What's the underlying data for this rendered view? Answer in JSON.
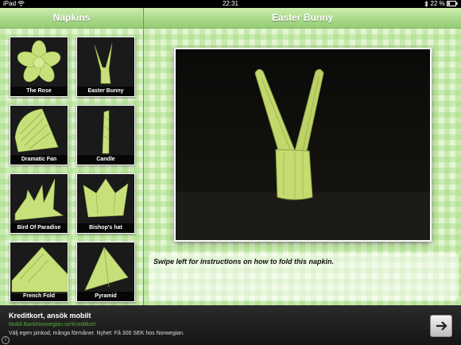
{
  "status_bar": {
    "device": "iPad",
    "wifi_icon": "wifi-icon",
    "time": "22:31",
    "battery_text": "22 %",
    "bluetooth_icon": "bluetooth-icon",
    "battery_icon": "battery-icon"
  },
  "sidebar": {
    "title": "Napkins",
    "items": [
      {
        "label": "The Rose"
      },
      {
        "label": "Easter Bunny"
      },
      {
        "label": "Dramatic Fan"
      },
      {
        "label": "Candle"
      },
      {
        "label": "Bird Of Paradise"
      },
      {
        "label": "Bishop's hat"
      },
      {
        "label": "French Fold"
      },
      {
        "label": "Pyramid"
      }
    ]
  },
  "detail": {
    "title": "Easter Bunny",
    "instruction": "Swipe left for instructions on how to fold this napkin."
  },
  "ad": {
    "title": "Kreditkort, ansök mobilt",
    "url": "Mobil.BankNorwegian.se/Kreditkort",
    "description": "Välj egen pinkod, många förmåner. Nyhet: Få 300 SEK hos Norwegian.",
    "info_icon": "info-icon",
    "button_icon": "arrow-right-icon"
  },
  "colors": {
    "napkin_green": "#c8e07a",
    "gingham_light": "#e4f5d2",
    "gingham_dark": "#a6d985",
    "navbar": "#a9d98a",
    "ad_link": "#5aa83b"
  }
}
